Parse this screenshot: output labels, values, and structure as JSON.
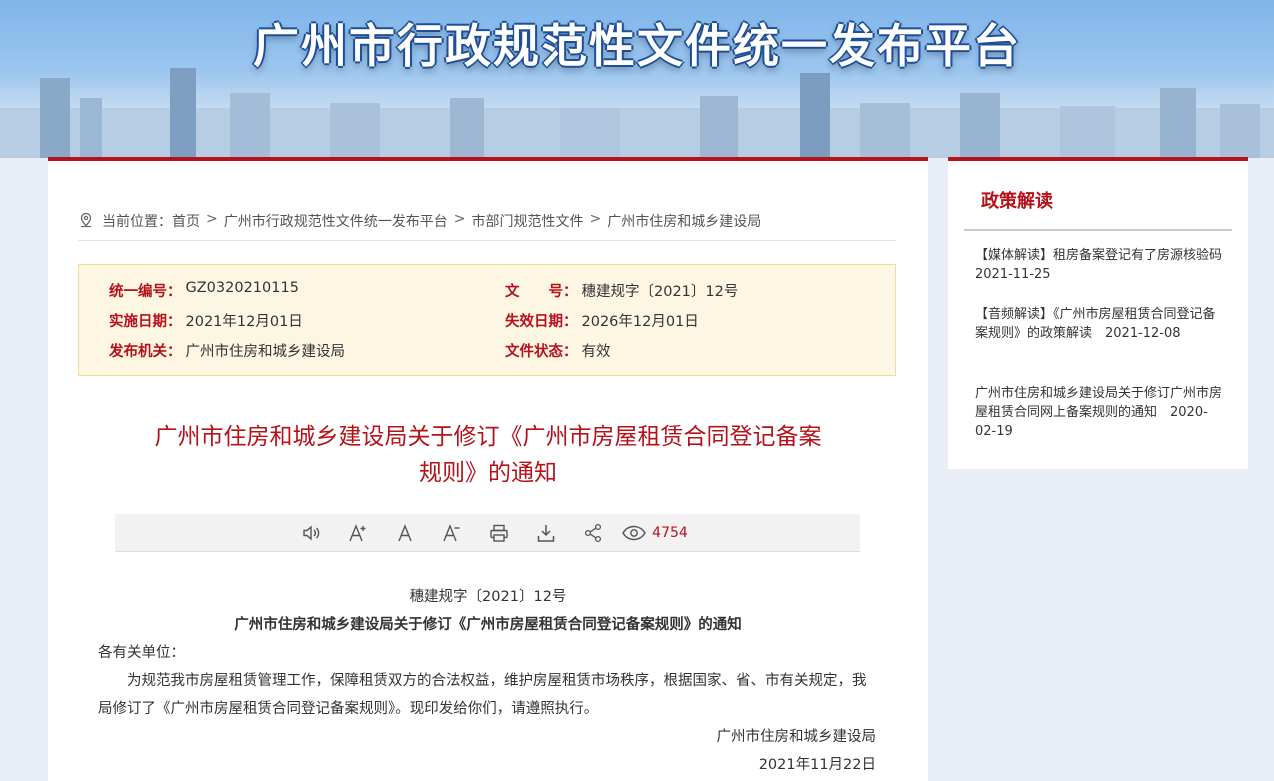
{
  "banner": {
    "title": "广州市行政规范性文件统一发布平台"
  },
  "breadcrumb": {
    "prefix": "当前位置：",
    "items": [
      "首页",
      "广州市行政规范性文件统一发布平台",
      "市部门规范性文件",
      "广州市住房和城乡建设局"
    ],
    "separator": ">"
  },
  "meta": {
    "serial_label": "统一编号：",
    "serial_value": "GZ0320210115",
    "docno_label": "文　　号：",
    "docno_value": "穗建规字〔2021〕12号",
    "impl_label": "实施日期：",
    "impl_value": "2021年12月01日",
    "expire_label": "失效日期：",
    "expire_value": "2026年12月01日",
    "issuer_label": "发布机关：",
    "issuer_value": "广州市住房和城乡建设局",
    "status_label": "文件状态：",
    "status_value": "有效"
  },
  "document": {
    "title_line1": "广州市住房和城乡建设局关于修订《广州市房屋租赁合同登记备案",
    "title_line2": "规则》的通知",
    "doc_number": "穗建规字〔2021〕12号",
    "heading": "广州市住房和城乡建设局关于修订《广州市房屋租赁合同登记备案规则》的通知",
    "salutation": "各有关单位：",
    "paragraph": "为规范我市房屋租赁管理工作，保障租赁双方的合法权益，维护房屋租赁市场秩序，根据国家、省、市有关规定，我局修订了《广州市房屋租赁合同登记备案规则》。现印发给你们，请遵照执行。",
    "signature": "广州市住房和城乡建设局",
    "date": "2021年11月22日"
  },
  "toolbar": {
    "views": "4754",
    "icons": [
      "speaker-icon",
      "font-increase-icon",
      "font-default-icon",
      "font-decrease-icon",
      "print-icon",
      "download-icon",
      "share-icon",
      "eye-icon"
    ]
  },
  "sidebar": {
    "title": "政策解读",
    "items": [
      "【媒体解读】租房备案登记有了房源核验码　2021-11-25",
      "【音频解读】《广州市房屋租赁合同登记备案规则》的政策解读　2021-12-08",
      "广州市住房和城乡建设局关于修订广州市房屋租赁合同网上备案规则的通知　2020-02-19"
    ]
  },
  "colors": {
    "accent": "#b5121b",
    "meta_bg": "#fdf6e3",
    "page_bg": "#e9eef6"
  }
}
